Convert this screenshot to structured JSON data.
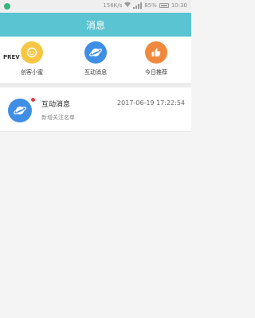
{
  "status_bar": {
    "network_speed": "156K/s",
    "battery": "85%",
    "time": "10:30"
  },
  "header": {
    "title": "消息"
  },
  "prev_label": "PREV",
  "shortcuts": [
    {
      "label": "创客小蜜",
      "color": "#f7c744",
      "icon": "face-icon"
    },
    {
      "label": "互动消息",
      "color": "#3f8ee5",
      "icon": "planet-icon"
    },
    {
      "label": "今日推荐",
      "color": "#f0893e",
      "icon": "thumbs-up-icon"
    }
  ],
  "notification": {
    "title": "互动消息",
    "time": "2017-06-19 17:22:54",
    "subtitle": "新增关注名单",
    "unread_color": "#e23b3b",
    "icon": "planet-icon"
  }
}
